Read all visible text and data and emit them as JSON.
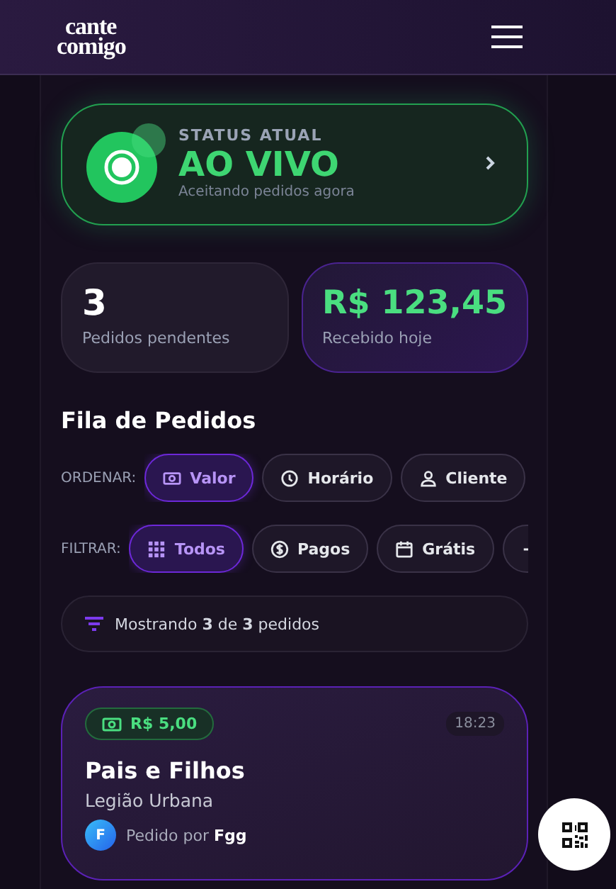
{
  "header": {
    "logo": [
      "cante",
      "comigo"
    ]
  },
  "status": {
    "label": "STATUS ATUAL",
    "value": "AO VIVO",
    "subtitle": "Aceitando pedidos agora",
    "live": true
  },
  "stats": [
    {
      "value": "3",
      "label": "Pedidos pendentes",
      "kind": "count"
    },
    {
      "value": "R$ 123,45",
      "label": "Recebido hoje",
      "kind": "money"
    }
  ],
  "queue": {
    "title": "Fila de Pedidos",
    "sort": {
      "label": "ORDENAR:",
      "options": [
        {
          "label": "Valor",
          "selected": true
        },
        {
          "label": "Horário",
          "selected": false
        },
        {
          "label": "Cliente",
          "selected": false
        }
      ]
    },
    "filter": {
      "label": "FILTRAR:",
      "options": [
        {
          "label": "Todos",
          "selected": true
        },
        {
          "label": "Pagos",
          "selected": false
        },
        {
          "label": "Grátis",
          "selected": false
        },
        {
          "selected": false
        }
      ]
    },
    "summary": "Mostrando **3** de **3** pedidos",
    "orders": [
      {
        "price": "R$ 5,00",
        "time": "18:23",
        "song": "Pais e Filhos",
        "artist": "Legião Urbana",
        "initial": "F",
        "requested_by": "Pedido por **Fgg**"
      }
    ]
  }
}
